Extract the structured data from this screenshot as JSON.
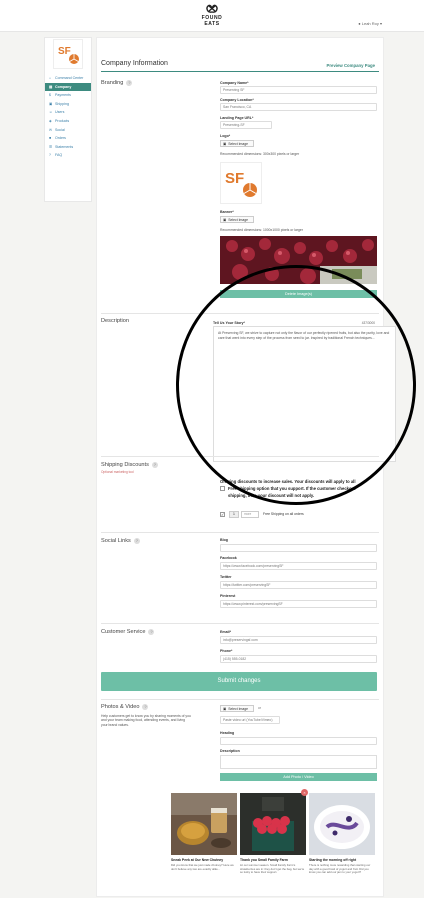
{
  "header": {
    "brand": "FOUND EATS",
    "user_menu": "Leah Roy ▾"
  },
  "sidebar": {
    "logo_text": "SF",
    "items": [
      {
        "label": "Command Center",
        "icon": "home-icon",
        "glyph": "⌂"
      },
      {
        "label": "Company",
        "icon": "company-icon",
        "glyph": "▤",
        "active": true
      },
      {
        "label": "Payments",
        "icon": "dollar-icon",
        "glyph": "$"
      },
      {
        "label": "Shipping",
        "icon": "truck-icon",
        "glyph": "▣"
      },
      {
        "label": "Users",
        "icon": "user-icon",
        "glyph": "☺"
      },
      {
        "label": "Products",
        "icon": "tag-icon",
        "glyph": "◈"
      },
      {
        "label": "Social",
        "icon": "share-icon",
        "glyph": "✉"
      },
      {
        "label": "Orders",
        "icon": "box-icon",
        "glyph": "■"
      },
      {
        "label": "Statements",
        "icon": "document-icon",
        "glyph": "☰"
      },
      {
        "label": "FAQ",
        "icon": "question-icon",
        "glyph": "?"
      }
    ]
  },
  "page": {
    "title": "Company Information",
    "preview_link": "Preview Company Page"
  },
  "branding": {
    "section": "Branding",
    "company_name_label": "Company Name*",
    "company_name": "Preserving SF",
    "location_label": "Company Location*",
    "location": "San Francisco, CA",
    "landing_label": "Landing Page URL*",
    "landing": "Preserving-SF",
    "logo_label": "Logo*",
    "select_image": "Select Image",
    "logo_hint": "Recommended dimensions: 300x300 pixels or larger",
    "banner_label": "Banner*",
    "banner_hint": "Recommended dimensions: 1000x1000 pixels or larger",
    "delete_banner": "Delete Image(s)"
  },
  "description": {
    "section": "Description",
    "field_label": "Tell Us Your Story*",
    "char_count": "437/3000",
    "story": "At Preserving SF, we strive to capture not only the flavor of our perfectly ripened fruits, but also the purity, love and care that went into every step of the process from seed to jar. Inspired by traditional French techniques..."
  },
  "shipping": {
    "section": "Shipping Discounts",
    "sub": "Optional marketing tool",
    "line1": "Offering discounts to increase sales. Your discounts will apply to all",
    "line2": "Free shipping option that you support. If the customer checkout",
    "line3": "shipping, then your discount will not apply.",
    "qty_value": "1",
    "qty_suffix": "more",
    "free_ship_text": "Free Shipping on all orders"
  },
  "social": {
    "section": "Social Links",
    "blog_label": "Blog",
    "blog": "",
    "facebook_label": "Facebook",
    "facebook": "https://www.facebook.com/preservingSF",
    "twitter_label": "Twitter",
    "twitter": "https://twitter.com/preservingSF",
    "pinterest_label": "Pinterest",
    "pinterest": "https://www.pinterest.com/preservingSF"
  },
  "customer_service": {
    "section": "Customer Service",
    "email_label": "Email*",
    "email": "info@preservingsf.com",
    "phone_label": "Phone*",
    "phone": "(415) 555-0182"
  },
  "submit": "Submit changes",
  "photos": {
    "section": "Photos & Video",
    "desc": "Help customers get to know you by sharing moments of you and your team making food, attending events, and living your brand values.",
    "select_image": "Select Image",
    "or": "or",
    "video_placeholder": "Paste video url (YouTube/Vimeo)",
    "heading_label": "Heading",
    "description_label": "Description",
    "add_button": "Add Photo / Video",
    "cards": [
      {
        "title": "Sneak Peek at Our New Chutney",
        "text": "Did you know that we just made chutney? Here we don't believe any two are exactly alike..."
      },
      {
        "title": "Thank you Small Family Farm",
        "text": "Lit our summer season. Small Family Farm's strawberries are in: they don't get the bag, but we're so lucky to have their support."
      },
      {
        "title": "Starting the morning off right",
        "text": "There is nothing more rewarding than starting our day with a good bowl of yogurt and fruit. Did you know you can add our jam to your yogurt?"
      }
    ]
  },
  "colors": {
    "accent": "#3d8b80",
    "button": "#6dbfa6",
    "logo_orange": "#e07a2e"
  }
}
